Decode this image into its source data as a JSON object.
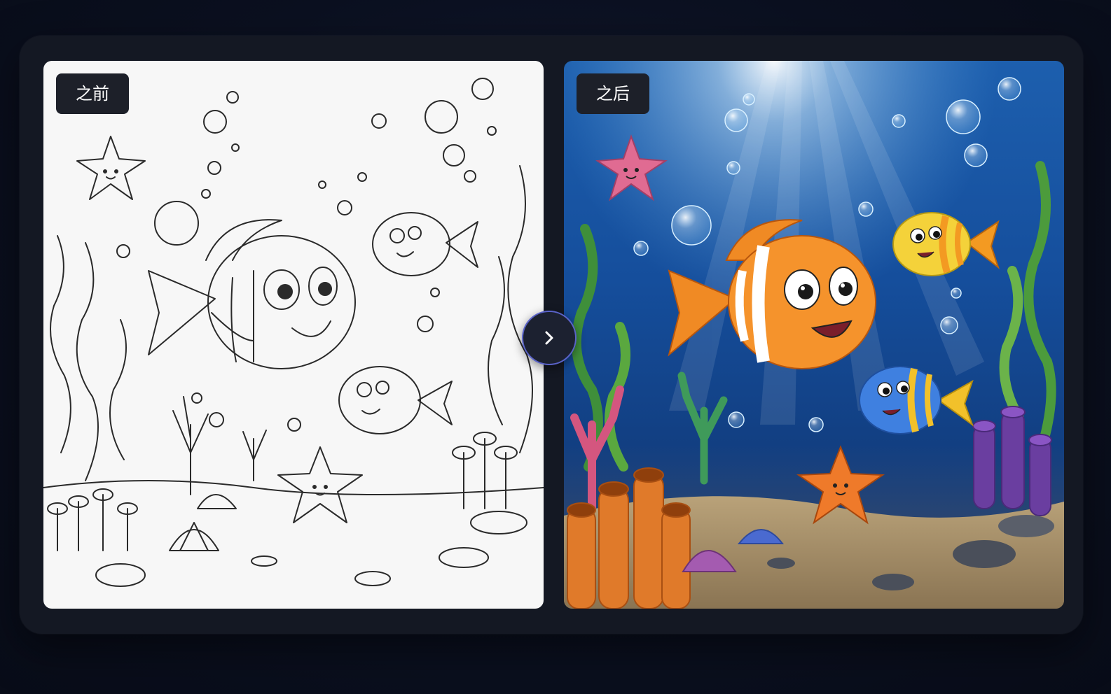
{
  "comparison": {
    "before_label": "之前",
    "after_label": "之后",
    "next_icon": "chevron-right-icon"
  },
  "colors": {
    "accent_ring": "#5a63c9",
    "badge_bg": "#1d2029",
    "card_bg": "#141823"
  }
}
